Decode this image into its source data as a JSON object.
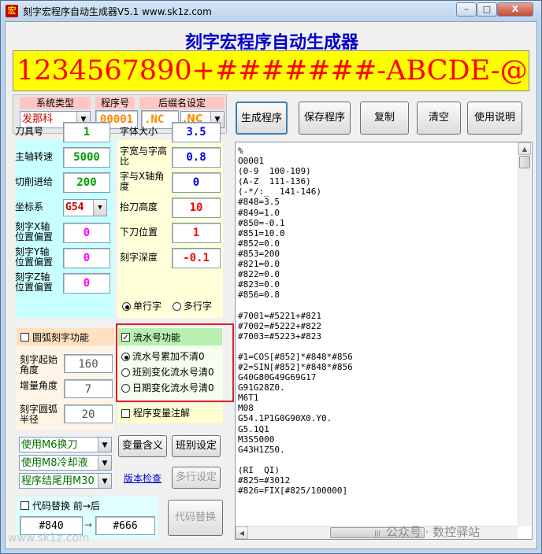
{
  "window": {
    "title": "刻字宏程序自动生成器V5.1    www.sk1z.com",
    "icon": "app-logo-icon",
    "controls": {
      "minimize": "–",
      "maximize": "□",
      "close": "X"
    }
  },
  "main_title": "刻字宏程序自动生成器",
  "banner_text": "1234567890+#######-ABCDE-@@@@-$",
  "header": {
    "system_type_label": "系统类型",
    "program_no_label": "程序号",
    "suffix_label": "后缀名设定"
  },
  "top_fields": {
    "system_type": "发那科",
    "program_no": "00001",
    "suffix1": ".NC",
    "suffix2": ".NC"
  },
  "params": [
    {
      "label": "刀具号",
      "value": "1",
      "color": "#00a000"
    },
    {
      "label": "主轴转速",
      "value": "5000",
      "color": "#00a000"
    },
    {
      "label": "切削进给",
      "value": "200",
      "color": "#00a000"
    },
    {
      "label": "坐标系",
      "value": "G54",
      "color": "#cc0000"
    },
    {
      "label": "刻字X轴位置偏置",
      "value": "0",
      "color": "#ff00ff"
    },
    {
      "label": "刻字Y轴位置偏置",
      "value": "0",
      "color": "#ff00ff"
    },
    {
      "label": "刻字Z轴位置偏置",
      "value": "0",
      "color": "#ff00ff"
    }
  ],
  "params_right": [
    {
      "label": "字体大小",
      "value": "3.5",
      "color": "#0000dd"
    },
    {
      "label": "字宽与字高比",
      "value": "0.8",
      "color": "#0000dd"
    },
    {
      "label": "字与X轴角度",
      "value": "0",
      "color": "#0000dd"
    },
    {
      "label": "抬刀高度",
      "value": "10",
      "color": "#ff0000"
    },
    {
      "label": "下刀位置",
      "value": "1",
      "color": "#ff0000"
    },
    {
      "label": "刻字深度",
      "value": "-0.1",
      "color": "#ff0000"
    }
  ],
  "line_mode": {
    "single": "单行字",
    "multi": "多行字"
  },
  "arc": {
    "label": "圆弧刻字功能",
    "start_angle_label": "刻字起始角度",
    "start_angle": "160",
    "increment_label": "增量角度",
    "increment": "7",
    "radius_label": "刻字圆弧半径",
    "radius": "20"
  },
  "serial": {
    "label": "流水号功能",
    "opt1": "流水号累加不清0",
    "opt2": "班别变化流水号清0",
    "opt3": "日期变化流水号清0"
  },
  "annotate_label": "程序变量注解",
  "dropdowns": {
    "tool_change": "使用M6换刀",
    "coolant": "使用M8冷却液",
    "end": "程序结尾用M30"
  },
  "buttons": {
    "variable_meaning": "变量含义",
    "shift_setting": "班别设定",
    "version_check": "版本检查",
    "multi_row_setting": "多行设定",
    "code_replace": "代码替换",
    "generate": "生成程序",
    "save": "保存程序",
    "copy": "复制",
    "clear": "清空",
    "help": "使用说明"
  },
  "replace": {
    "label": "代码替换  前→后",
    "from": "#840",
    "to": "#666",
    "arrow": "→"
  },
  "code_lines": [
    "%",
    "O0001",
    "(0-9  100-109)",
    "(A-Z  111-136)",
    "(-*/:_  141-146)",
    "#848=3.5",
    "#849=1.0",
    "#850=-0.1",
    "#851=10.0",
    "#852=0.0",
    "#853=200",
    "#821=0.0",
    "#822=0.0",
    "#823=0.0",
    "#856=0.8",
    "",
    "#7001=#5221+#821",
    "#7002=#5222+#822",
    "#7003=#5223+#823",
    "",
    "#1=COS[#852]*#848*#856",
    "#2=SIN[#852]*#848*#856",
    "G40G80G49G69G17",
    "G91G28Z0.",
    "M6T1",
    "M08",
    "G54.1P1G0G90X0.Y0.",
    "G5.1Q1",
    "M3S5000",
    "G43H1Z50.",
    "",
    "(RI  QI)",
    "#825=#3012",
    "#826=FIX[#825/100000]"
  ],
  "watermarks": {
    "left": "www.sk1z.com",
    "right": "公众号 · 数控驿站"
  }
}
